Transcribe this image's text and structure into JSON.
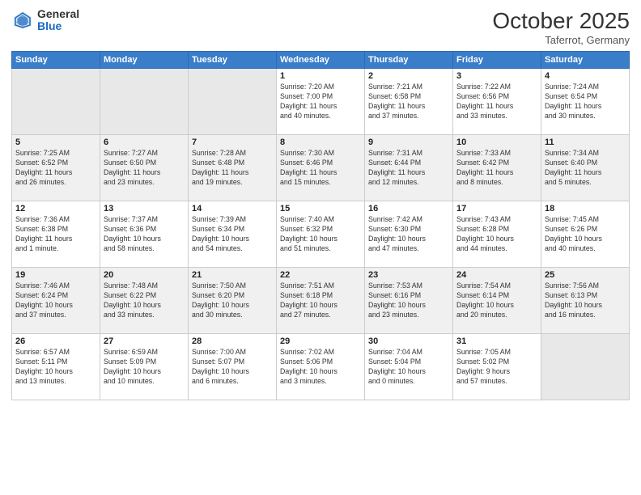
{
  "header": {
    "logo_general": "General",
    "logo_blue": "Blue",
    "month_title": "October 2025",
    "location": "Taferrot, Germany"
  },
  "days_of_week": [
    "Sunday",
    "Monday",
    "Tuesday",
    "Wednesday",
    "Thursday",
    "Friday",
    "Saturday"
  ],
  "weeks": [
    [
      {
        "day": "",
        "info": ""
      },
      {
        "day": "",
        "info": ""
      },
      {
        "day": "",
        "info": ""
      },
      {
        "day": "1",
        "info": "Sunrise: 7:20 AM\nSunset: 7:00 PM\nDaylight: 11 hours\nand 40 minutes."
      },
      {
        "day": "2",
        "info": "Sunrise: 7:21 AM\nSunset: 6:58 PM\nDaylight: 11 hours\nand 37 minutes."
      },
      {
        "day": "3",
        "info": "Sunrise: 7:22 AM\nSunset: 6:56 PM\nDaylight: 11 hours\nand 33 minutes."
      },
      {
        "day": "4",
        "info": "Sunrise: 7:24 AM\nSunset: 6:54 PM\nDaylight: 11 hours\nand 30 minutes."
      }
    ],
    [
      {
        "day": "5",
        "info": "Sunrise: 7:25 AM\nSunset: 6:52 PM\nDaylight: 11 hours\nand 26 minutes."
      },
      {
        "day": "6",
        "info": "Sunrise: 7:27 AM\nSunset: 6:50 PM\nDaylight: 11 hours\nand 23 minutes."
      },
      {
        "day": "7",
        "info": "Sunrise: 7:28 AM\nSunset: 6:48 PM\nDaylight: 11 hours\nand 19 minutes."
      },
      {
        "day": "8",
        "info": "Sunrise: 7:30 AM\nSunset: 6:46 PM\nDaylight: 11 hours\nand 15 minutes."
      },
      {
        "day": "9",
        "info": "Sunrise: 7:31 AM\nSunset: 6:44 PM\nDaylight: 11 hours\nand 12 minutes."
      },
      {
        "day": "10",
        "info": "Sunrise: 7:33 AM\nSunset: 6:42 PM\nDaylight: 11 hours\nand 8 minutes."
      },
      {
        "day": "11",
        "info": "Sunrise: 7:34 AM\nSunset: 6:40 PM\nDaylight: 11 hours\nand 5 minutes."
      }
    ],
    [
      {
        "day": "12",
        "info": "Sunrise: 7:36 AM\nSunset: 6:38 PM\nDaylight: 11 hours\nand 1 minute."
      },
      {
        "day": "13",
        "info": "Sunrise: 7:37 AM\nSunset: 6:36 PM\nDaylight: 10 hours\nand 58 minutes."
      },
      {
        "day": "14",
        "info": "Sunrise: 7:39 AM\nSunset: 6:34 PM\nDaylight: 10 hours\nand 54 minutes."
      },
      {
        "day": "15",
        "info": "Sunrise: 7:40 AM\nSunset: 6:32 PM\nDaylight: 10 hours\nand 51 minutes."
      },
      {
        "day": "16",
        "info": "Sunrise: 7:42 AM\nSunset: 6:30 PM\nDaylight: 10 hours\nand 47 minutes."
      },
      {
        "day": "17",
        "info": "Sunrise: 7:43 AM\nSunset: 6:28 PM\nDaylight: 10 hours\nand 44 minutes."
      },
      {
        "day": "18",
        "info": "Sunrise: 7:45 AM\nSunset: 6:26 PM\nDaylight: 10 hours\nand 40 minutes."
      }
    ],
    [
      {
        "day": "19",
        "info": "Sunrise: 7:46 AM\nSunset: 6:24 PM\nDaylight: 10 hours\nand 37 minutes."
      },
      {
        "day": "20",
        "info": "Sunrise: 7:48 AM\nSunset: 6:22 PM\nDaylight: 10 hours\nand 33 minutes."
      },
      {
        "day": "21",
        "info": "Sunrise: 7:50 AM\nSunset: 6:20 PM\nDaylight: 10 hours\nand 30 minutes."
      },
      {
        "day": "22",
        "info": "Sunrise: 7:51 AM\nSunset: 6:18 PM\nDaylight: 10 hours\nand 27 minutes."
      },
      {
        "day": "23",
        "info": "Sunrise: 7:53 AM\nSunset: 6:16 PM\nDaylight: 10 hours\nand 23 minutes."
      },
      {
        "day": "24",
        "info": "Sunrise: 7:54 AM\nSunset: 6:14 PM\nDaylight: 10 hours\nand 20 minutes."
      },
      {
        "day": "25",
        "info": "Sunrise: 7:56 AM\nSunset: 6:13 PM\nDaylight: 10 hours\nand 16 minutes."
      }
    ],
    [
      {
        "day": "26",
        "info": "Sunrise: 6:57 AM\nSunset: 5:11 PM\nDaylight: 10 hours\nand 13 minutes."
      },
      {
        "day": "27",
        "info": "Sunrise: 6:59 AM\nSunset: 5:09 PM\nDaylight: 10 hours\nand 10 minutes."
      },
      {
        "day": "28",
        "info": "Sunrise: 7:00 AM\nSunset: 5:07 PM\nDaylight: 10 hours\nand 6 minutes."
      },
      {
        "day": "29",
        "info": "Sunrise: 7:02 AM\nSunset: 5:06 PM\nDaylight: 10 hours\nand 3 minutes."
      },
      {
        "day": "30",
        "info": "Sunrise: 7:04 AM\nSunset: 5:04 PM\nDaylight: 10 hours\nand 0 minutes."
      },
      {
        "day": "31",
        "info": "Sunrise: 7:05 AM\nSunset: 5:02 PM\nDaylight: 9 hours\nand 57 minutes."
      },
      {
        "day": "",
        "info": ""
      }
    ]
  ]
}
